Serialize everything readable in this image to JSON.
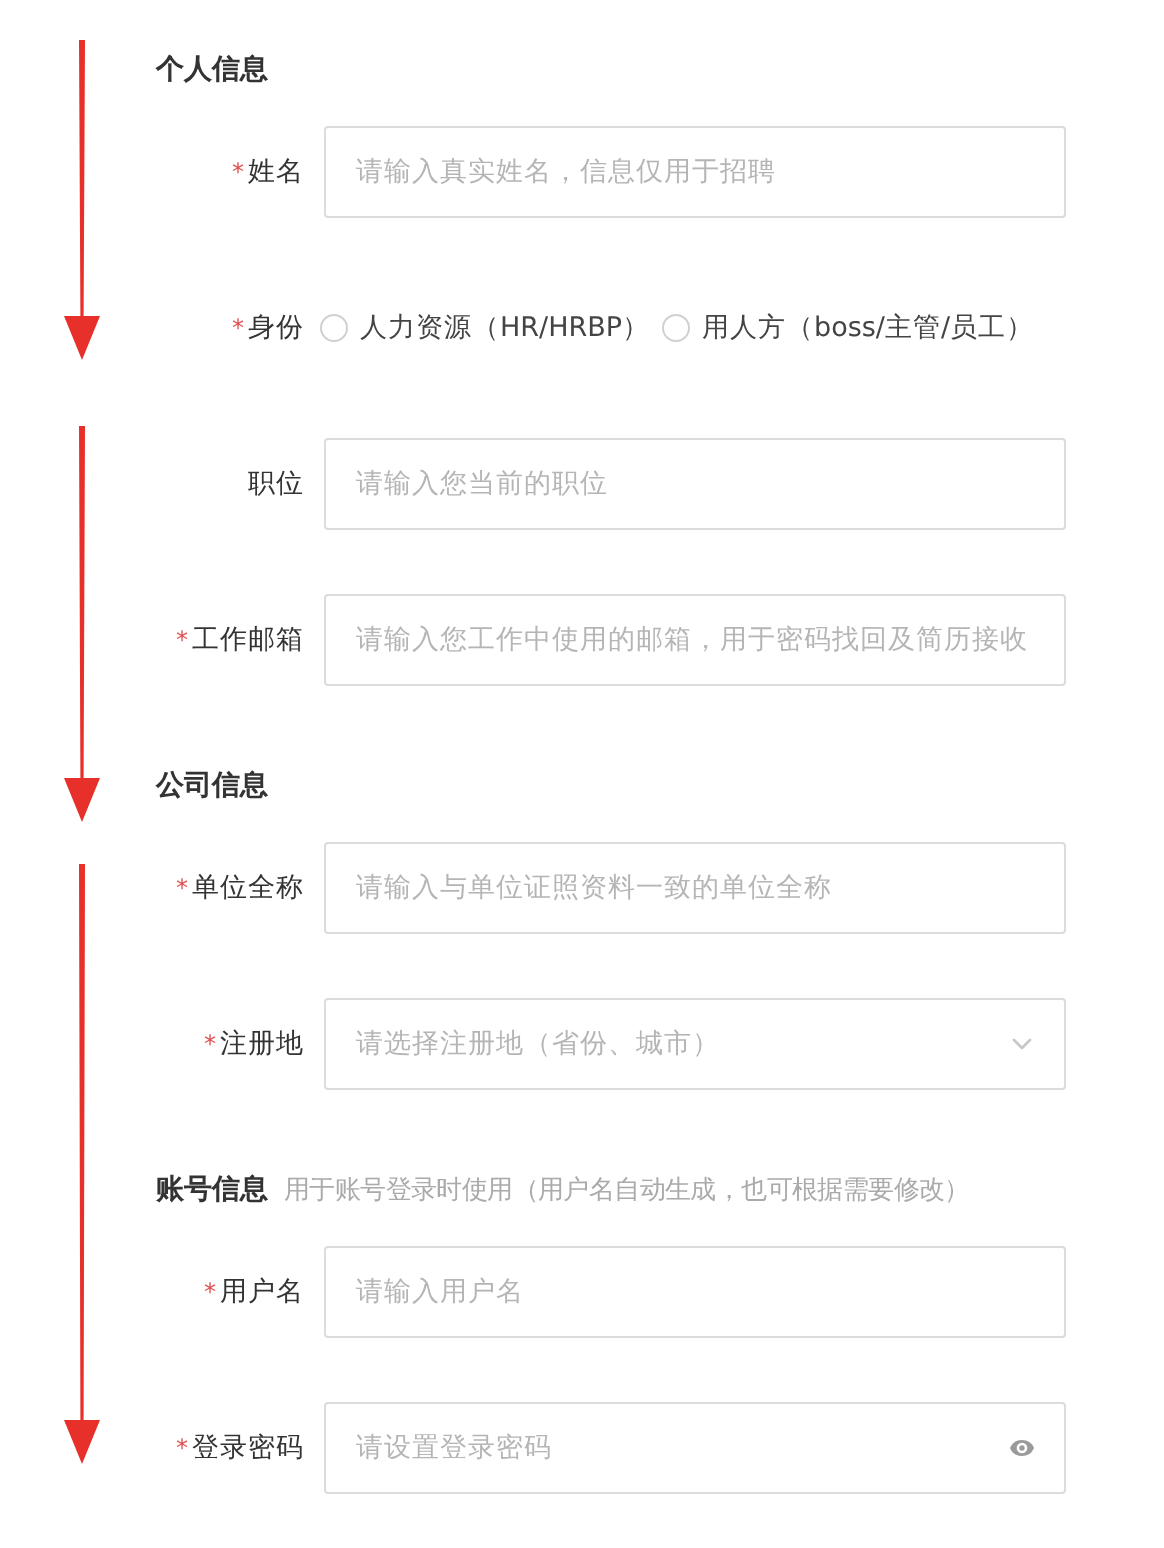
{
  "annotations": [
    {
      "kind": "arrow"
    },
    {
      "kind": "arrow"
    },
    {
      "kind": "arrow"
    }
  ],
  "sections": [
    {
      "title": "个人信息",
      "fields": [
        {
          "kind": "text",
          "required_mark": "*",
          "label": "姓名",
          "placeholder": "请输入真实姓名，信息仅用于招聘"
        },
        {
          "kind": "radio",
          "required_mark": "*",
          "label": "身份",
          "options": [
            {
              "label": "人力资源（HR/HRBP）",
              "selected": false
            },
            {
              "label": "用人方（boss/主管/员工）",
              "selected": false
            }
          ]
        },
        {
          "kind": "text",
          "label": "职位",
          "placeholder": "请输入您当前的职位"
        },
        {
          "kind": "text",
          "required_mark": "*",
          "label": "工作邮箱",
          "placeholder": "请输入您工作中使用的邮箱，用于密码找回及简历接收"
        }
      ]
    },
    {
      "title": "公司信息",
      "fields": [
        {
          "kind": "text",
          "required_mark": "*",
          "label": "单位全称",
          "placeholder": "请输入与单位证照资料一致的单位全称"
        },
        {
          "kind": "select",
          "required_mark": "*",
          "label": "注册地",
          "placeholder": "请选择注册地（省份、城市）"
        }
      ]
    },
    {
      "title": "账号信息",
      "note": "用于账号登录时使用（用户名自动生成，也可根据需要修改）",
      "fields": [
        {
          "kind": "text",
          "required_mark": "*",
          "label": "用户名",
          "placeholder": "请输入用户名"
        },
        {
          "kind": "password",
          "required_mark": "*",
          "label": "登录密码",
          "placeholder": "请设置登录密码"
        }
      ]
    }
  ]
}
